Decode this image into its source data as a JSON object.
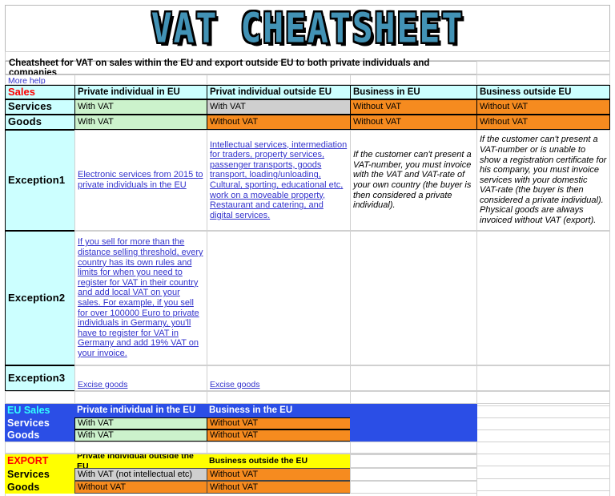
{
  "title": "VAT CHEATSHEET",
  "subtitle": "Cheatsheet for VAT on sales within the EU and export outside EU to both private individuals and companies",
  "more_help_link": "More help",
  "colors": {
    "title_blue": "#4292b5",
    "cyan": "#ccffff",
    "green": "#ccf2cc",
    "orange": "#f68b1f",
    "gray": "#cfcfcf",
    "blue": "#2b4ee6",
    "yellow": "#ffff00",
    "link": "#3333cc",
    "red": "#ff0000"
  },
  "sales_table": {
    "corner_label": "Sales",
    "headers": [
      "Private individual in EU",
      "Privat individual outside EU",
      "Business in EU",
      "Business outside EU"
    ],
    "rows": [
      {
        "label": "Services",
        "cells": [
          {
            "text": "With VAT",
            "fill": "green"
          },
          {
            "text": "With VAT",
            "fill": "gray"
          },
          {
            "text": "Without VAT",
            "fill": "orange"
          },
          {
            "text": "Without VAT",
            "fill": "orange"
          }
        ]
      },
      {
        "label": "Goods",
        "cells": [
          {
            "text": "With VAT",
            "fill": "green"
          },
          {
            "text": "Without VAT",
            "fill": "orange"
          },
          {
            "text": "Without VAT",
            "fill": "orange"
          },
          {
            "text": "Without VAT",
            "fill": "orange"
          }
        ]
      }
    ],
    "exception1": {
      "label": "Exception1",
      "col1": "Electronic services from 2015 to private individuals in the EU",
      "col2": "Intellectual services, intermediation for traders, property services, passenger transports, goods transport, loading/unloading, Cultural, sporting, educational etc, work on a moveable property, Restaurant and catering, and digital services.",
      "col3": "If the customer can't present a VAT-number, you must invoice with the VAT and VAT-rate of your own country (the buyer is then considered a private individual).",
      "col4": "If the customer can't present a VAT-number or is unable to show a registration certificate for his company, you must invoice services with your domestic VAT-rate (the buyer is then considered a private individual). Physical goods are always invoiced without VAT (export)."
    },
    "exception2": {
      "label": "Exception2",
      "col1": "If you sell for more than the distance selling threshold, every country has its own rules and limits for when you need to register for VAT in their country and add local VAT on your sales. For example, if you sell for over 100000 Euro to private individuals in Germany, you'll have to register for VAT in Germany and add 19% VAT on your invoice.",
      "col2": "",
      "col3": "",
      "col4": ""
    },
    "exception3": {
      "label": "Exception3",
      "col1": "Excise goods",
      "col2": "Excise goods",
      "col3": "",
      "col4": ""
    }
  },
  "eu_sales_table": {
    "corner_label": "EU Sales",
    "headers": [
      "Private individual in the EU",
      "Business in the EU"
    ],
    "rows": [
      {
        "label": "Services",
        "cells": [
          {
            "text": "With VAT",
            "fill": "green"
          },
          {
            "text": "Without VAT",
            "fill": "orange"
          }
        ]
      },
      {
        "label": "Goods",
        "cells": [
          {
            "text": "With VAT",
            "fill": "green"
          },
          {
            "text": "Without VAT",
            "fill": "orange"
          }
        ]
      }
    ]
  },
  "export_table": {
    "corner_label": "EXPORT",
    "headers": [
      "Private individual outside the EU",
      "Business outside the EU"
    ],
    "rows": [
      {
        "label": "Services",
        "cells": [
          {
            "text": "With VAT (not intellectual etc)",
            "fill": "gray"
          },
          {
            "text": "Without VAT",
            "fill": "orange"
          }
        ]
      },
      {
        "label": "Goods",
        "cells": [
          {
            "text": "Without VAT",
            "fill": "orange"
          },
          {
            "text": "Without VAT",
            "fill": "orange"
          }
        ]
      }
    ]
  }
}
